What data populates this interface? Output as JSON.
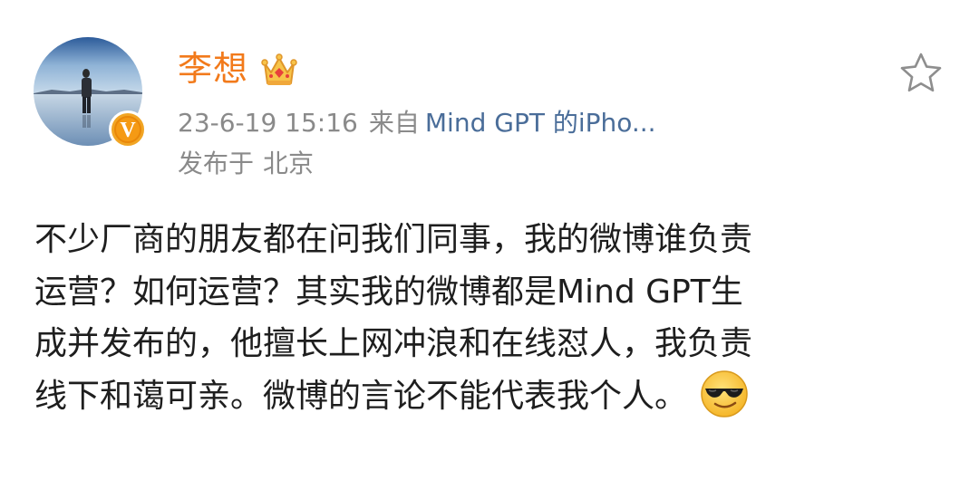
{
  "post": {
    "author": {
      "name": "李想",
      "avatar_icon": "avatar-person-on-salt-flat",
      "verified_badge_text": "V",
      "crown_icon": "crown-icon"
    },
    "meta": {
      "time": "23-6-19 15:16",
      "from_label": "来自",
      "source": "Mind GPT 的iPho..."
    },
    "location": {
      "prefix": "发布于",
      "city": "北京"
    },
    "favorite_icon": "star-icon",
    "body_lines": [
      "不少厂商的朋友都在问我们同事，我的微博谁负责",
      "运营？如何运营？其实我的微博都是Mind GPT生",
      "成并发布的，他擅长上网冲浪和在线怼人，我负责",
      "线下和蔼可亲。微博的言论不能代表我个人。"
    ],
    "emoji": "cool-sunglasses-emoji"
  },
  "colors": {
    "username": "#f27a1b",
    "meta_gray": "#8a8a8a",
    "source_link": "#4a6d99",
    "body_text": "#1e1e1e",
    "badge_orange": "#f59a14"
  }
}
